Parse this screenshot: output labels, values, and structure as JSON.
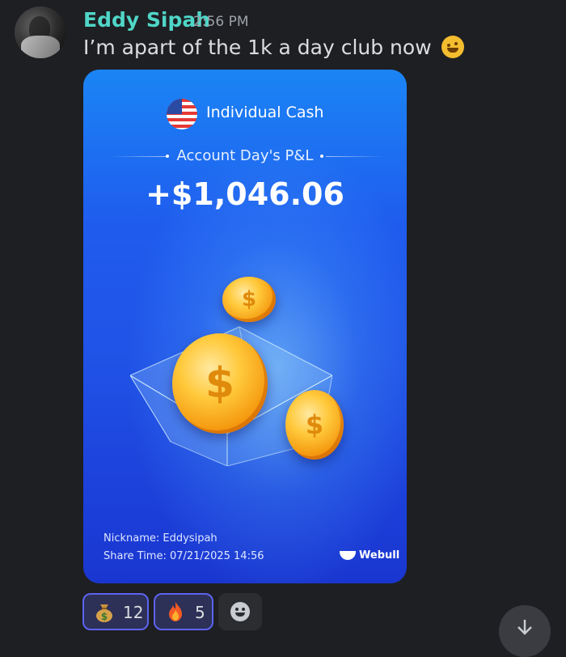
{
  "message": {
    "author": "Eddy Sipah",
    "timestamp": "2:56 PM",
    "text": "I’m apart of the 1k a day club now",
    "text_emoji": "rolling-on-floor-laughing-emoji"
  },
  "card": {
    "account_name": "Individual Cash",
    "flag_icon": "us-flag-icon",
    "pl_label": "Account Day's P&L",
    "pl_value": "+$1,046.06",
    "nickname": "Nickname: Eddysipah",
    "share_time": "Share Time: 07/21/2025 14:56",
    "brand": "Webull",
    "colors": {
      "top": "#1b85f5",
      "bottom": "#1a36d0",
      "coin": "#ffc93b"
    }
  },
  "reactions": [
    {
      "emoji": "money-bag-emoji",
      "count": "12",
      "active": true
    },
    {
      "emoji": "fire-emoji",
      "count": "5",
      "active": true
    }
  ],
  "add_reaction_icon": "smiley-face-icon",
  "scroll_icon": "arrow-down-icon",
  "colors": {
    "background": "#1e1f23",
    "username": "#4fd6c7",
    "reaction_border": "#5c64f0"
  }
}
